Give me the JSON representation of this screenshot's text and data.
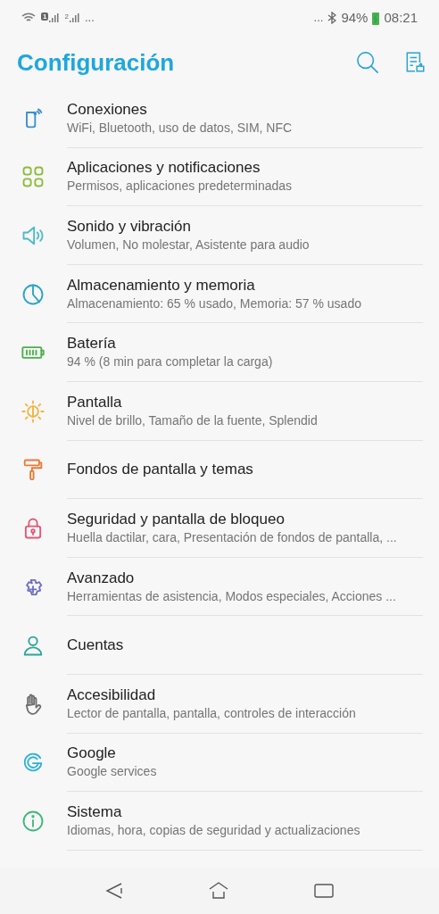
{
  "status_bar": {
    "sim_1": "1",
    "sim_2": "2",
    "left_more": "...",
    "right_more": "...",
    "battery": "94%",
    "time": "08:21"
  },
  "header": {
    "title": "Configuración"
  },
  "items": [
    {
      "title": "Conexiones",
      "subtitle": "WiFi, Bluetooth, uso de datos, SIM, NFC",
      "color": "#3a8fd0"
    },
    {
      "title": "Aplicaciones y notificaciones",
      "subtitle": "Permisos, aplicaciones predeterminadas",
      "color": "#8dbb3c"
    },
    {
      "title": "Sonido y vibración",
      "subtitle": "Volumen, No molestar, Asistente para audio",
      "color": "#4bbac9"
    },
    {
      "title": "Almacenamiento y memoria",
      "subtitle": "Almacenamiento: 65 % usado, Memoria: 57 % usado",
      "color": "#2aa3c8"
    },
    {
      "title": "Batería",
      "subtitle": "94 % (8 min para completar la carga)",
      "color": "#49b04a"
    },
    {
      "title": "Pantalla",
      "subtitle": "Nivel de brillo, Tamaño de la fuente, Splendid",
      "color": "#f2b33d"
    },
    {
      "title": "Fondos de pantalla y temas",
      "color": "#ec7a35"
    },
    {
      "title": "Seguridad y pantalla de bloqueo",
      "subtitle": "Huella dactilar, cara, Presentación de fondos de pantalla, ...",
      "color": "#e4567a"
    },
    {
      "title": "Avanzado",
      "subtitle": "Herramientas de asistencia, Modos especiales, Acciones ...",
      "color": "#6f6fc4"
    },
    {
      "title": "Cuentas",
      "color": "#2aa59a"
    },
    {
      "title": "Accesibilidad",
      "subtitle": "Lector de pantalla, pantalla, controles de interacción",
      "color": "#6e6e6e"
    },
    {
      "title": "Google",
      "subtitle": "Google services",
      "color": "#2fb2d6"
    },
    {
      "title": "Sistema",
      "subtitle": "Idiomas, hora, copias de seguridad y actualizaciones",
      "color": "#3fb77c"
    }
  ]
}
